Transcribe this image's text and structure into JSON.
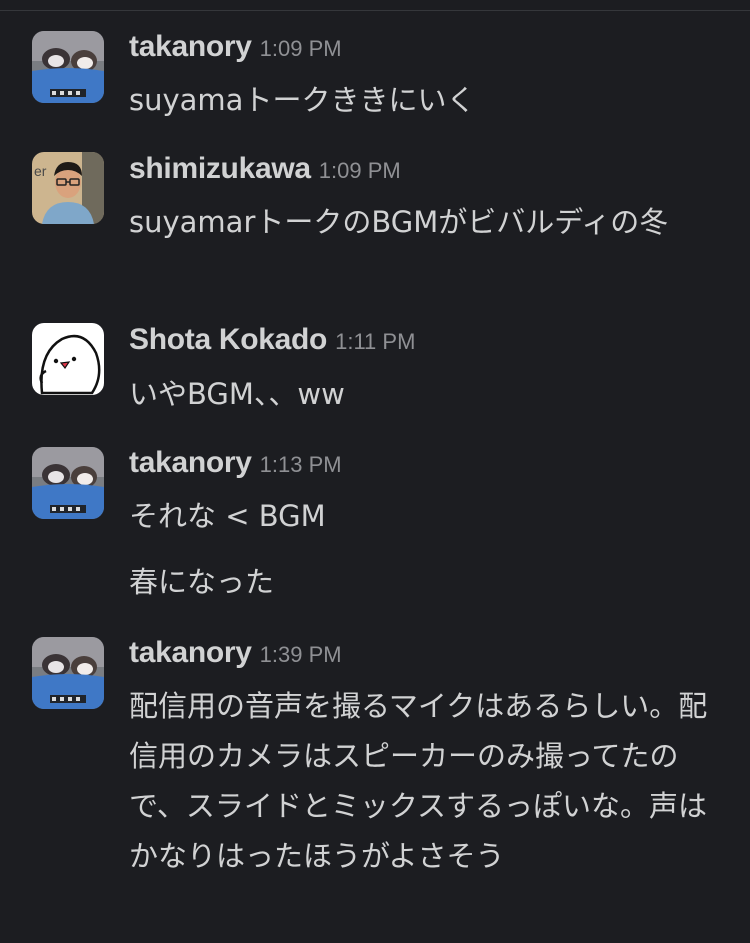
{
  "messages": [
    {
      "author": "takanory",
      "time": "1:09 PM",
      "avatar": "ferret-avatar",
      "text": "suyamaトークききにいく"
    },
    {
      "author": "shimizukawa",
      "time": "1:09 PM",
      "avatar": "person-avatar",
      "text": "suyamarトークのBGMがビバルディの冬"
    },
    {
      "author": "Shota Kokado",
      "time": "1:11 PM",
      "avatar": "bird-avatar",
      "text": "いやBGM、、ww"
    },
    {
      "author": "takanory",
      "time": "1:13 PM",
      "avatar": "ferret-avatar",
      "text": "それな < BGM",
      "followup": "春になった"
    },
    {
      "author": "takanory",
      "time": "1:39 PM",
      "avatar": "ferret-avatar",
      "text": "配信用の音声を撮るマイクはあるらしい。配信用のカメラはスピーカーのみ撮ってたので、スライドとミックスするっぽいな。声はかなりはったほうがよさそう"
    }
  ]
}
